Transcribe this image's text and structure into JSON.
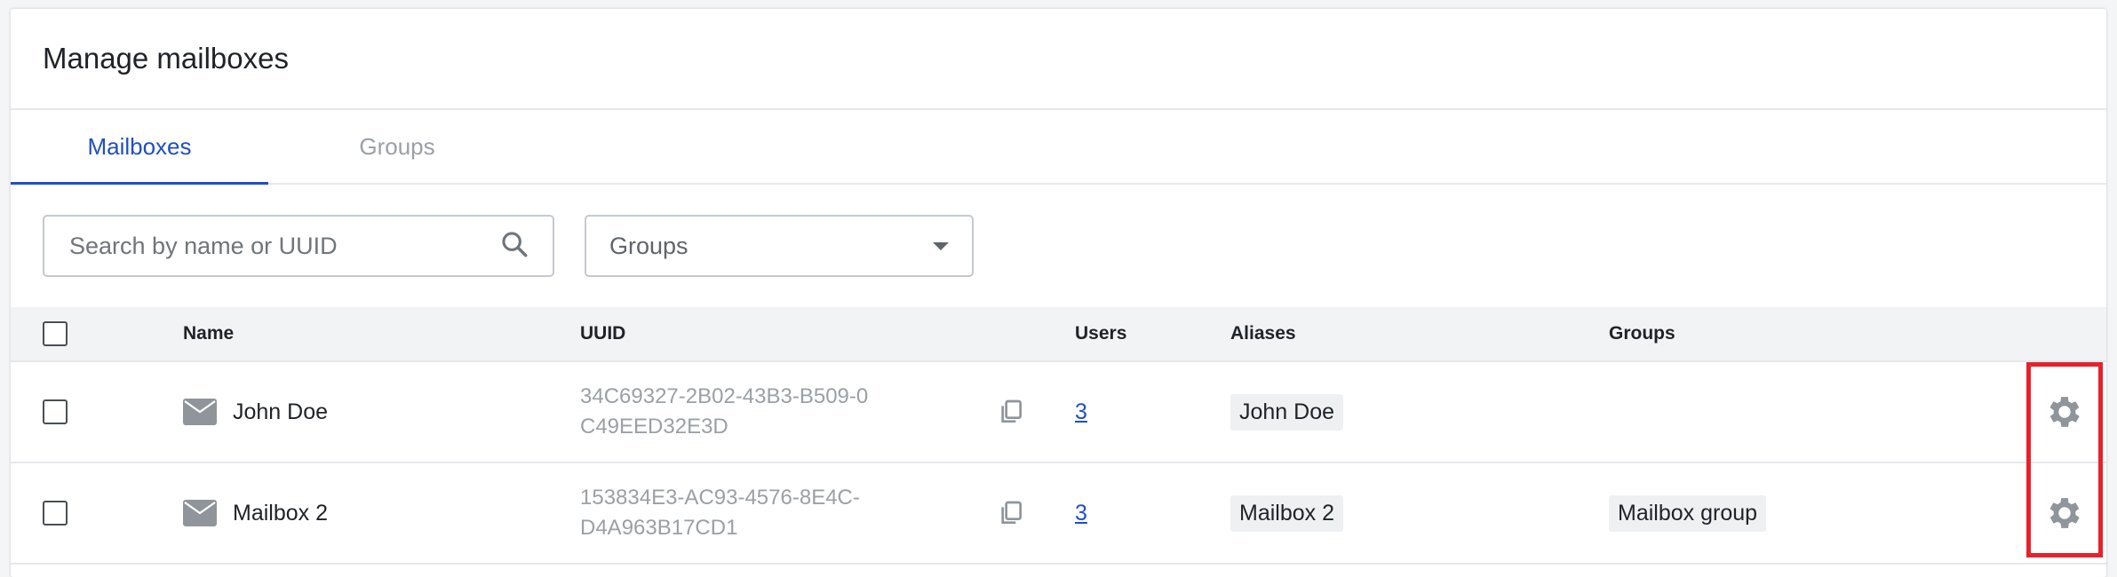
{
  "page": {
    "title": "Manage mailboxes"
  },
  "tabs": [
    {
      "label": "Mailboxes",
      "active": true
    },
    {
      "label": "Groups",
      "active": false
    }
  ],
  "filters": {
    "search_placeholder": "Search by name or UUID",
    "groups_select": "Groups"
  },
  "table": {
    "headers": {
      "name": "Name",
      "uuid": "UUID",
      "users": "Users",
      "aliases": "Aliases",
      "groups": "Groups"
    },
    "rows": [
      {
        "name": "John Doe",
        "uuid": "34C69327-2B02-43B3-B509-0C49EED32E3D",
        "users": "3",
        "alias": "John Doe",
        "group": ""
      },
      {
        "name": "Mailbox 2",
        "uuid": "153834E3-AC93-4576-8E4C-D4A963B17CD1",
        "users": "3",
        "alias": "Mailbox 2",
        "group": "Mailbox group"
      }
    ]
  },
  "icons": {
    "search": "search-icon",
    "dropdown": "chevron-down-icon",
    "mail": "mail-icon",
    "copy": "copy-icon",
    "settings": "gear-icon"
  },
  "colors": {
    "accent": "#1e4ec8",
    "highlight": "#e5232d"
  }
}
